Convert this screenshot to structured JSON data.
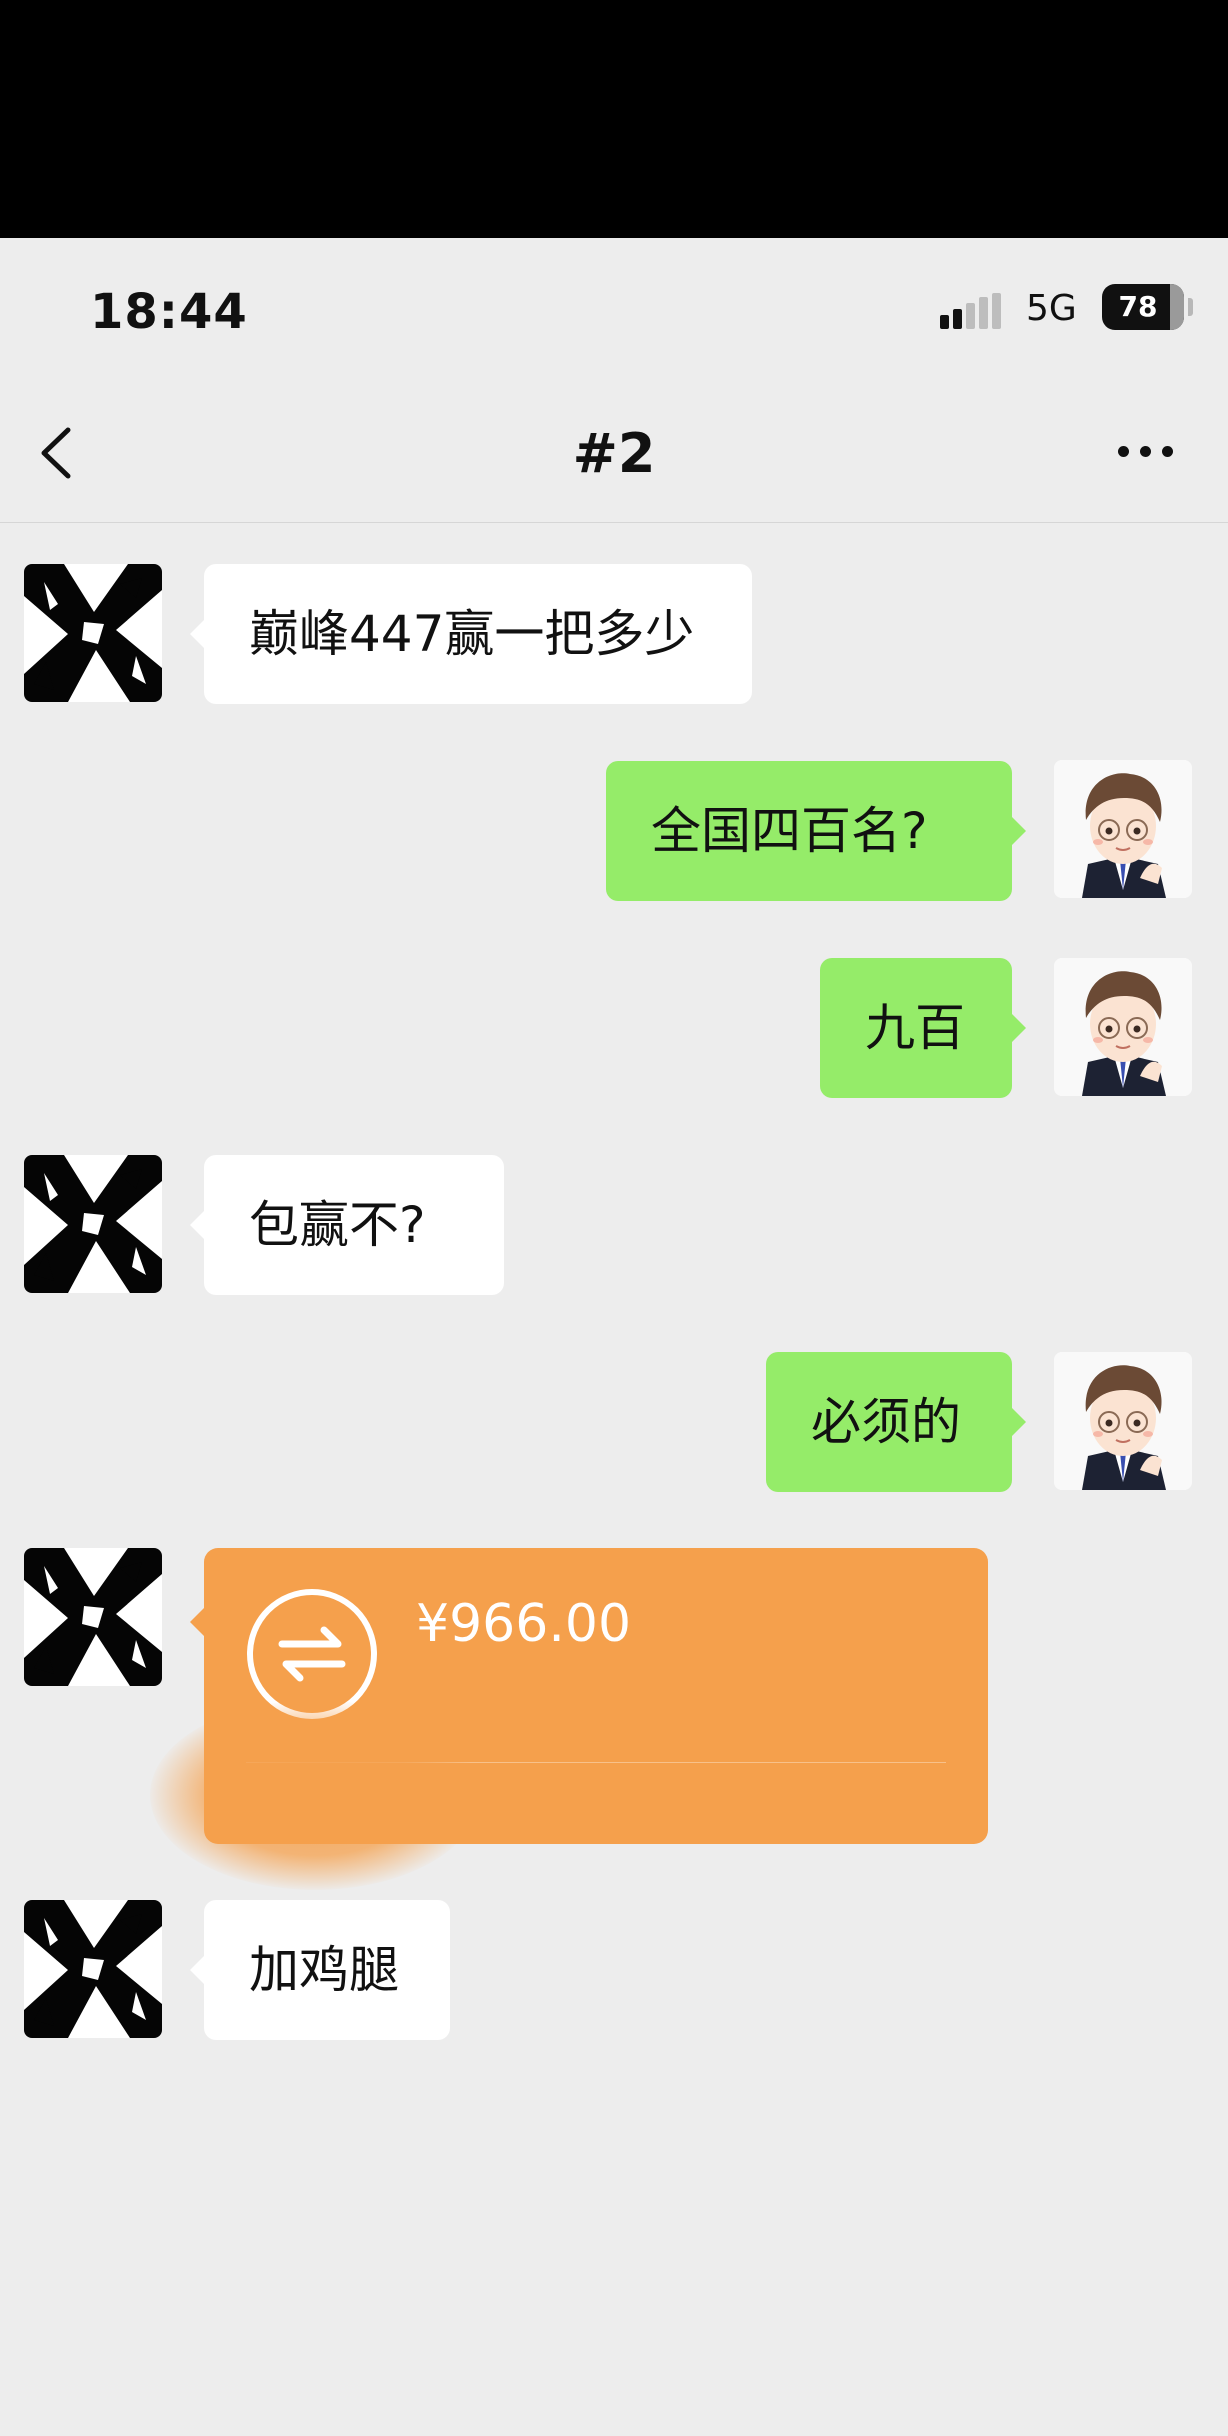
{
  "status_bar": {
    "time": "18:44",
    "network": "5G",
    "battery": "78"
  },
  "header": {
    "title": "#2",
    "back_icon": "chevron-left-icon",
    "more_icon": "more-horizontal-icon"
  },
  "messages": [
    {
      "side": "left",
      "text": "巅峰447赢一把多少"
    },
    {
      "side": "right",
      "text": "全国四百名?"
    },
    {
      "side": "right",
      "text": "九百"
    },
    {
      "side": "left",
      "text": "包赢不?"
    },
    {
      "side": "right",
      "text": "必须的"
    },
    {
      "side": "left",
      "type": "transfer",
      "amount": "¥966.00",
      "icon": "transfer-arrows-icon"
    },
    {
      "side": "left",
      "text": "加鸡腿"
    }
  ],
  "colors": {
    "self_bubble": "#95ec69",
    "other_bubble": "#ffffff",
    "transfer_card": "#f5a04c",
    "background": "#ededed"
  }
}
